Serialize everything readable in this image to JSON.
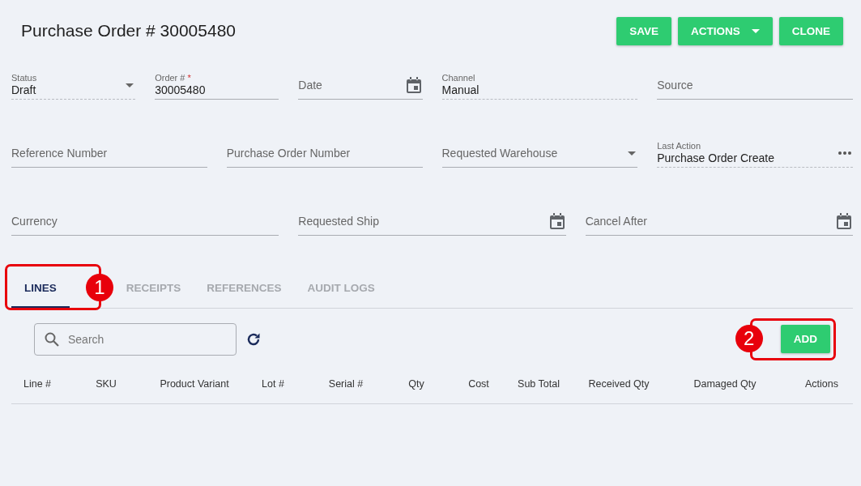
{
  "header": {
    "title": "Purchase Order # 30005480",
    "buttons": [
      {
        "label": "SAVE",
        "kind": "plain"
      },
      {
        "label": "ACTIONS",
        "kind": "menu"
      },
      {
        "label": "CLONE",
        "kind": "plain"
      }
    ]
  },
  "form": {
    "fields": [
      {
        "label": "Status",
        "value": "Draft",
        "kind": "select",
        "readonly": true
      },
      {
        "label": "Order #",
        "value": "30005480",
        "kind": "text",
        "readonly": false,
        "required_mark": "*"
      },
      {
        "label": "Date",
        "kind": "date",
        "readonly": false
      },
      {
        "label": "Channel",
        "value": "Manual",
        "kind": "text",
        "readonly": true
      },
      {
        "label": "Source",
        "kind": "text",
        "readonly": false
      },
      {
        "label": "Reference Number",
        "kind": "text",
        "readonly": false
      },
      {
        "label": "Purchase Order Number",
        "kind": "text",
        "readonly": false
      },
      {
        "label": "Requested Warehouse",
        "kind": "select",
        "readonly": false
      },
      {
        "label": "Last Action",
        "value": "Purchase Order Create",
        "kind": "more",
        "readonly": true
      },
      {
        "label": "Currency",
        "kind": "text",
        "readonly": false
      },
      {
        "label": "Requested Ship",
        "kind": "date",
        "readonly": false
      },
      {
        "label": "Cancel After",
        "kind": "date",
        "readonly": false
      }
    ]
  },
  "tabs": [
    {
      "label": "LINES",
      "selected": true
    },
    {
      "label": "RECEIPTS",
      "selected": false
    },
    {
      "label": "REFERENCES",
      "selected": false
    },
    {
      "label": "AUDIT LOGS",
      "selected": false
    }
  ],
  "toolbar": {
    "search": {
      "placeholder": "Search"
    },
    "add_button": "ADD"
  },
  "table": {
    "columns": [
      "Line #",
      "SKU",
      "Product Variant",
      "Lot #",
      "Serial #",
      "Qty",
      "Cost",
      "Sub Total",
      "Received Qty",
      "Damaged Qty",
      "Actions"
    ]
  },
  "annotations": [
    {
      "number": "1"
    },
    {
      "number": "2"
    }
  ]
}
